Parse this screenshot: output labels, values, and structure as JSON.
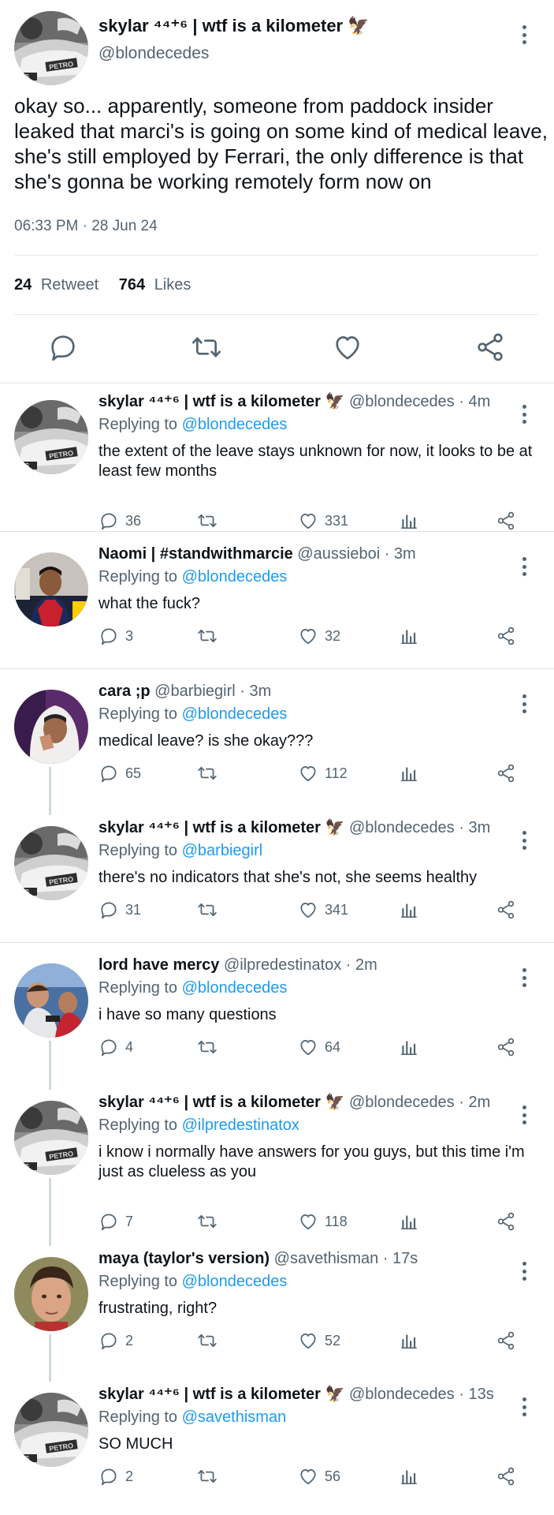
{
  "main_tweet": {
    "name": "skylar ⁴⁴⁺⁶ | wtf is a kilometer 🦅",
    "handle": "@blondecedes",
    "text": "okay so... apparently, someone from paddock insider leaked that marci's is going on some kind of medical leave, she's still employed by Ferrari, the only difference is that she's gonna be working remotely form now on",
    "timestamp": "06:33 PM · 28 Jun 24",
    "retweets": "24",
    "retweet_label": "Retweet",
    "likes": "764",
    "likes_label": "Likes"
  },
  "replies": [
    {
      "name": "skylar ⁴⁴⁺⁶ | wtf is a kilometer 🦅",
      "handle": "@blondecedes · 4m",
      "replying_label": "Replying to",
      "replying_to": "@blondecedes",
      "text": "the extent of the leave stays unknown for now, it looks to be at least few months",
      "replies": "36",
      "likes": "331",
      "avatar": "car-bw"
    },
    {
      "name": "Naomi | #standwithmarcie",
      "handle": "@aussieboi · 3m",
      "replying_label": "Replying to",
      "replying_to": "@blondecedes",
      "text": "what the fuck?",
      "replies": "3",
      "likes": "32",
      "avatar": "man-dark"
    },
    {
      "name": "cara ;p",
      "handle": "@barbiegirl · 3m",
      "replying_label": "Replying to",
      "replying_to": "@blondecedes",
      "text": "medical leave? is she okay???",
      "replies": "65",
      "likes": "112",
      "avatar": "hood"
    },
    {
      "name": "skylar ⁴⁴⁺⁶ | wtf is a kilometer 🦅",
      "handle": "@blondecedes · 3m",
      "replying_label": "Replying to",
      "replying_to": "@barbiegirl",
      "text": "there's no indicators that she's not, she seems healthy",
      "replies": "31",
      "likes": "341",
      "avatar": "car-bw"
    },
    {
      "name": "lord have mercy",
      "handle": "@ilpredestinatox · 2m",
      "replying_label": "Replying to",
      "replying_to": "@blondecedes",
      "text": "i have so many questions",
      "replies": "4",
      "likes": "64",
      "avatar": "crowd"
    },
    {
      "name": "skylar ⁴⁴⁺⁶ | wtf is a kilometer 🦅",
      "handle": "@blondecedes · 2m",
      "replying_label": "Replying to",
      "replying_to": "@ilpredestinatox",
      "text": "i know i normally have answers for you guys, but this time i'm just as clueless as you",
      "replies": "7",
      "likes": "118",
      "avatar": "car-bw"
    },
    {
      "name": "maya (taylor's version)",
      "handle": "@savethisman · 17s",
      "replying_label": "Replying to",
      "replying_to": "@blondecedes",
      "text": "frustrating, right?",
      "replies": "2",
      "likes": "52",
      "avatar": "face"
    },
    {
      "name": "skylar ⁴⁴⁺⁶ | wtf is a kilometer 🦅",
      "handle": "@blondecedes · 13s",
      "replying_label": "Replying to",
      "replying_to": "@savethisman",
      "text": "SO MUCH",
      "replies": "2",
      "likes": "56",
      "avatar": "car-bw"
    }
  ],
  "icons": {
    "more": "more-vertical-icon",
    "reply": "reply-bubble-icon",
    "retweet": "retweet-icon",
    "like": "heart-icon",
    "views": "analytics-icon",
    "share": "share-icon"
  },
  "colors": {
    "link": "#1d9bf0",
    "muted": "#536471",
    "text": "#0f1419",
    "divider": "#dfe3e6"
  }
}
